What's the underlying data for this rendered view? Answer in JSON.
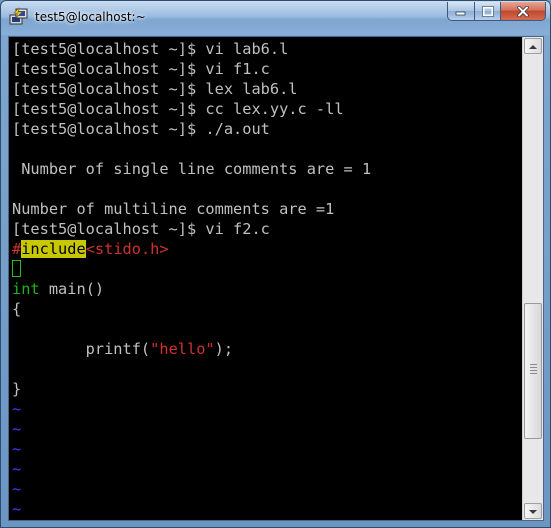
{
  "window": {
    "title": "test5@localhost:~"
  },
  "icons": {
    "app": "putty-icon",
    "minimize": "minimize-icon",
    "maximize": "maximize-icon",
    "close": "close-icon",
    "scroll_up": "chevron-up-icon",
    "scroll_down": "chevron-down-icon"
  },
  "colors": {
    "terminal_bg": "#000000",
    "text": "#c0c0c0",
    "preproc_highlight": "#c8c800",
    "string": "#d03030",
    "keyword": "#20b020",
    "tilde": "#3a3aff",
    "close_button": "#c0482d"
  },
  "terminal": {
    "lines": [
      "[test5@localhost ~]$ vi lab6.l",
      "[test5@localhost ~]$ vi f1.c",
      "[test5@localhost ~]$ lex lab6.l",
      "[test5@localhost ~]$ cc lex.yy.c -ll",
      "[test5@localhost ~]$ ./a.out",
      "",
      " Number of single line comments are = 1",
      "",
      "Number of multiline comments are =1",
      "[test5@localhost ~]$ vi f2.c"
    ],
    "vi": {
      "hash": "#",
      "include": "include",
      "header": "<stido.h>",
      "int_kw": "int",
      "main_rest": " main()",
      "open_brace": "{",
      "printf_indent": "        printf(",
      "string_literal": "\"hello\"",
      "printf_end": ");",
      "close_brace": "}",
      "tilde": "~"
    }
  }
}
